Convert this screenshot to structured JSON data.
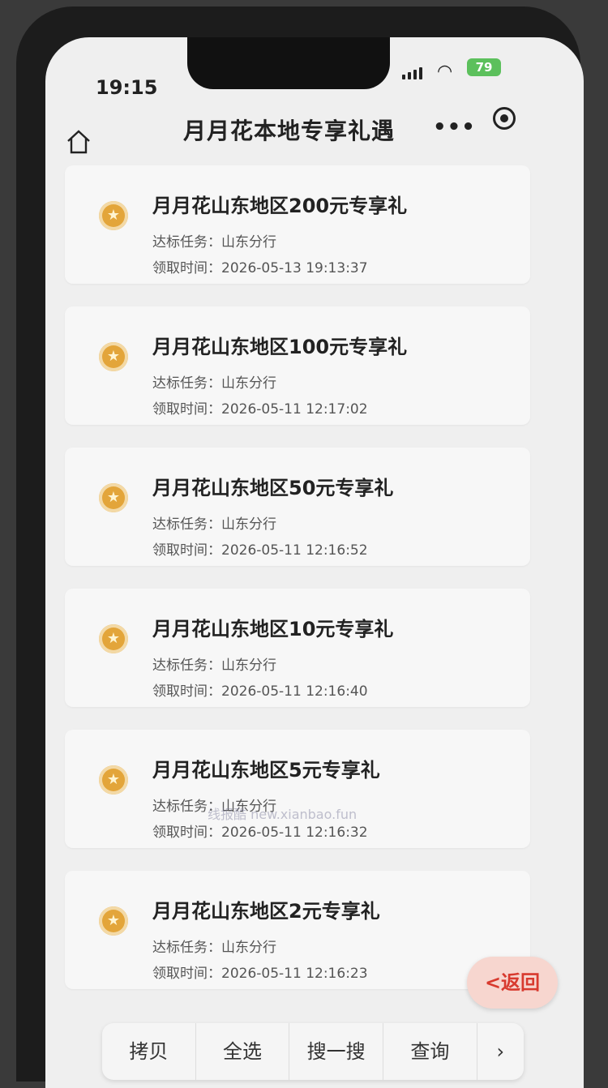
{
  "status": {
    "time": "19:15",
    "battery": "79"
  },
  "nav": {
    "title": "月月花本地专享礼遇"
  },
  "cards": [
    {
      "title": "月月花山东地区200元专享礼",
      "task_label": "达标任务：",
      "task": "山东分行",
      "time_label": "领取时间：",
      "time": "2026-05-13 19:13:37"
    },
    {
      "title": "月月花山东地区100元专享礼",
      "task_label": "达标任务：",
      "task": "山东分行",
      "time_label": "领取时间：",
      "time": "2026-05-11 12:17:02"
    },
    {
      "title": "月月花山东地区50元专享礼",
      "task_label": "达标任务：",
      "task": "山东分行",
      "time_label": "领取时间：",
      "time": "2026-05-11 12:16:52"
    },
    {
      "title": "月月花山东地区10元专享礼",
      "task_label": "达标任务：",
      "task": "山东分行",
      "time_label": "领取时间：",
      "time": "2026-05-11 12:16:40"
    },
    {
      "title": "月月花山东地区5元专享礼",
      "task_label": "达标任务：",
      "task": "山东分行",
      "time_label": "领取时间：",
      "time": "2026-05-11 12:16:32"
    },
    {
      "title": "月月花山东地区2元专享礼",
      "task_label": "达标任务：",
      "task": "山东分行",
      "time_label": "领取时间：",
      "time": "2026-05-11 12:16:23"
    }
  ],
  "toolbar": {
    "copy": "拷贝",
    "select_all": "全选",
    "search": "搜一搜",
    "lookup": "查询",
    "more": "›"
  },
  "back_button": "<返回",
  "watermark": "线报酷 new.xianbao.fun"
}
